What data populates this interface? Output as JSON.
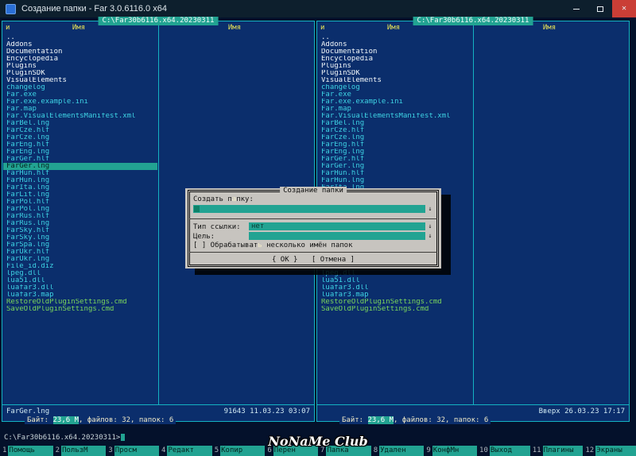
{
  "window": {
    "title": "Создание папки - Far 3.0.6116.0 x64"
  },
  "titlebar_icons": {
    "close": "✕"
  },
  "panels": {
    "path": "C:\\Far30b6116.x64.20230311",
    "sort_indicator": "и",
    "column_header": "Имя",
    "files": [
      {
        "name": "..",
        "type": "dir"
      },
      {
        "name": "Addons",
        "type": "dir"
      },
      {
        "name": "Documentation",
        "type": "dir"
      },
      {
        "name": "Encyclopedia",
        "type": "dir"
      },
      {
        "name": "Plugins",
        "type": "dir"
      },
      {
        "name": "PluginSDK",
        "type": "dir"
      },
      {
        "name": "VisualElements",
        "type": "dir"
      },
      {
        "name": "changelog",
        "type": "file"
      },
      {
        "name": "Far.exe",
        "type": "file"
      },
      {
        "name": "Far.exe.example.ini",
        "type": "file"
      },
      {
        "name": "Far.map",
        "type": "file"
      },
      {
        "name": "Far.VisualElementsManifest.xml",
        "type": "file"
      },
      {
        "name": "FarBel.lng",
        "type": "file"
      },
      {
        "name": "FarCze.hlf",
        "type": "file"
      },
      {
        "name": "FarCze.lng",
        "type": "file"
      },
      {
        "name": "FarEng.hlf",
        "type": "file"
      },
      {
        "name": "FarEng.lng",
        "type": "file"
      },
      {
        "name": "FarGer.hlf",
        "type": "file"
      },
      {
        "name": "FarGer.lng",
        "type": "file"
      },
      {
        "name": "FarHun.hlf",
        "type": "file"
      },
      {
        "name": "FarHun.lng",
        "type": "file"
      },
      {
        "name": "FarIta.lng",
        "type": "file"
      },
      {
        "name": "FarLit.lng",
        "type": "file"
      },
      {
        "name": "FarPol.hlf",
        "type": "file"
      },
      {
        "name": "FarPol.lng",
        "type": "file"
      },
      {
        "name": "FarRus.hlf",
        "type": "file"
      },
      {
        "name": "FarRus.lng",
        "type": "file"
      },
      {
        "name": "FarSky.hlf",
        "type": "file"
      },
      {
        "name": "FarSky.lng",
        "type": "file"
      },
      {
        "name": "FarSpa.lng",
        "type": "file"
      },
      {
        "name": "FarUkr.hlf",
        "type": "file"
      },
      {
        "name": "FarUkr.lng",
        "type": "file"
      },
      {
        "name": "File_id.diz",
        "type": "file"
      },
      {
        "name": "lpeg.dll",
        "type": "file"
      },
      {
        "name": "lua51.dll",
        "type": "file"
      },
      {
        "name": "luafar3.dll",
        "type": "file"
      },
      {
        "name": "luafar3.map",
        "type": "file"
      },
      {
        "name": "RestoreOldPluginSettings.cmd",
        "type": "cmd"
      },
      {
        "name": "SaveOldPluginSettings.cmd",
        "type": "cmd"
      }
    ],
    "left": {
      "cursor": "FarGer.lng",
      "status_name": "FarGer.lng",
      "status_info": "91643 11.03.23 03:07"
    },
    "right": {
      "status_name": "",
      "status_info": "Вверх 26.03.23 17:17"
    },
    "totals": {
      "prefix": "Байт: ",
      "size": "23,6 М",
      "suffix": ", файлов: 32, папок: 6"
    }
  },
  "dialog": {
    "title": "Создание папки",
    "create_label": {
      "pre": "Создать п",
      "hotkey": "а",
      "post": "пку:"
    },
    "link_type_label": "Тип ссылки:",
    "link_type_value": "нет",
    "target_label": "Цель:",
    "checkbox_box": "[ ]",
    "checkbox_label": {
      "pre": " Обрабатыват",
      "hotkey": "ь",
      "post": " несколько имён папок"
    },
    "ok_button": "{ ОК }",
    "cancel_button": "[ Отмена ]",
    "history_arrow": "↓"
  },
  "command_line": {
    "prompt": "C:\\Far30b6116.x64.20230311>"
  },
  "keybar": [
    {
      "key": "1",
      "label": "Помощь"
    },
    {
      "key": "2",
      "label": "ПользМ"
    },
    {
      "key": "3",
      "label": "Просм"
    },
    {
      "key": "4",
      "label": "Редакт"
    },
    {
      "key": "5",
      "label": "Копир"
    },
    {
      "key": "6",
      "label": "Перен"
    },
    {
      "key": "7",
      "label": "Папка"
    },
    {
      "key": "8",
      "label": "Удален"
    },
    {
      "key": "9",
      "label": "КонфМн"
    },
    {
      "key": "10",
      "label": "Выход"
    },
    {
      "key": "11",
      "label": "Плагины"
    },
    {
      "key": "12",
      "label": "Экраны"
    }
  ],
  "watermark": "NoNaMe Club",
  "colors": {
    "panel_bg": "#0b2e6c",
    "panel_border": "#14b2c2",
    "accent_teal": "#22a392",
    "file_text": "#3ed3e4",
    "dir_text": "#f4f9fb",
    "cmd_text": "#7bd65c",
    "header_yellow": "#e7e056",
    "dialog_bg": "#c7c4bf",
    "titlebar_bg": "#0d1f2d",
    "close_button": "#ca3e36"
  }
}
